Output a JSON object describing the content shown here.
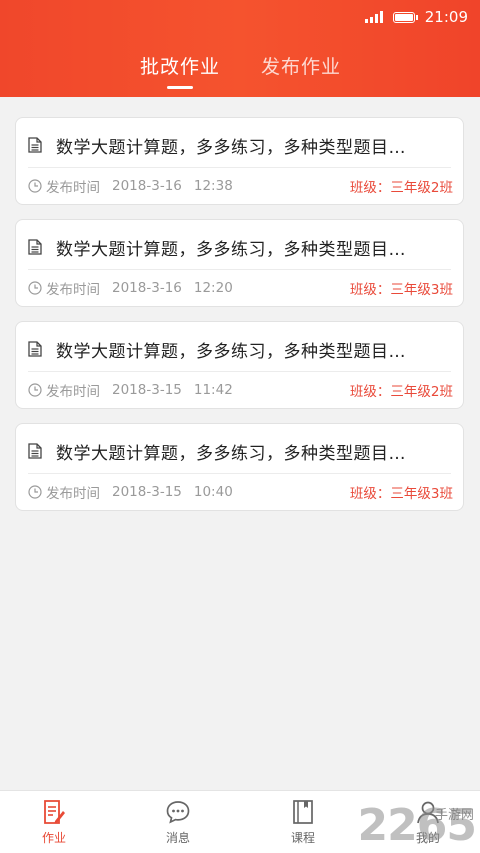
{
  "status_bar": {
    "time": "21:09"
  },
  "tabs": [
    {
      "label": "批改作业",
      "active": true
    },
    {
      "label": "发布作业",
      "active": false
    }
  ],
  "assignments": [
    {
      "title": "数学大题计算题，多多练习，多种类型题目…",
      "time_label": "发布时间",
      "date": "2018-3-16",
      "time": "12:38",
      "class": "班级：三年级2班"
    },
    {
      "title": "数学大题计算题，多多练习，多种类型题目…",
      "time_label": "发布时间",
      "date": "2018-3-16",
      "time": "12:20",
      "class": "班级：三年级3班"
    },
    {
      "title": "数学大题计算题，多多练习，多种类型题目…",
      "time_label": "发布时间",
      "date": "2018-3-15",
      "time": "11:42",
      "class": "班级：三年级2班"
    },
    {
      "title": "数学大题计算题，多多练习，多种类型题目…",
      "time_label": "发布时间",
      "date": "2018-3-15",
      "time": "10:40",
      "class": "班级：三年级3班"
    }
  ],
  "bottom_nav": [
    {
      "label": "作业",
      "icon": "homework-icon",
      "active": true
    },
    {
      "label": "消息",
      "icon": "message-icon",
      "active": false
    },
    {
      "label": "课程",
      "icon": "course-icon",
      "active": false
    },
    {
      "label": "我的",
      "icon": "profile-icon",
      "active": false
    }
  ],
  "watermark": {
    "brand": "2265",
    "sub": "手游网"
  },
  "colors": {
    "header": "#f34d2d",
    "accent": "#e84a36",
    "background": "#f2f2f2"
  }
}
